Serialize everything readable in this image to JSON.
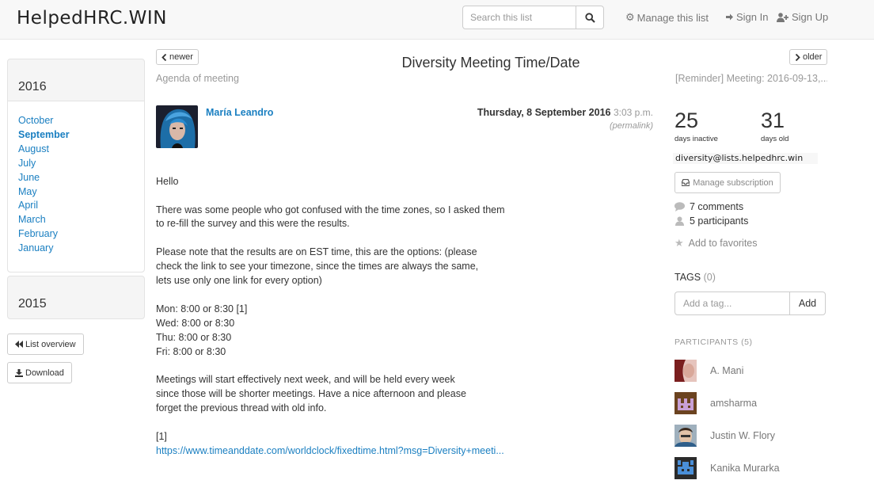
{
  "navbar": {
    "brand": "HelpedHRC.WIN",
    "search_placeholder": "Search this list",
    "manage": "Manage this list",
    "sign_in": "Sign In",
    "sign_up": "Sign Up"
  },
  "sidebar": {
    "year_current": "2016",
    "months": [
      "October",
      "September",
      "August",
      "July",
      "June",
      "May",
      "April",
      "March",
      "February",
      "January"
    ],
    "active_month": "September",
    "year_previous": "2015",
    "list_overview": "List overview",
    "download": "Download"
  },
  "thread": {
    "newer": "newer",
    "older": "older",
    "title": "Diversity Meeting Time/Date",
    "prev_thread": "Agenda of meeting",
    "next_thread": "[Reminder] Meeting: 2016-09-13,..."
  },
  "message": {
    "sender": "María Leandro",
    "date": "Thursday, 8 September 2016",
    "time": "3:03 p.m.",
    "permalink": "(permalink)",
    "body": [
      "Hello",
      "There was some people who got confused with the time zones, so I asked them",
      "to re-fill the survey and this were the results.",
      "Please note that the results are on EST time, this are the options: (please",
      "check the link to see your timezone, since the times are always the same,",
      "lets use only one link for every option)",
      "Mon: 8:00 or 8:30 [1]",
      "Wed: 8:00 or 8:30",
      "Thu: 8:00 or 8:30",
      "Fri: 8:00 or 8:30",
      "Meetings will start effectively next week, and will be held every week",
      "since those will be shorter meetings. Have a nice afternoon and please",
      "forget the previous thread with old info.",
      "[1]"
    ],
    "link": "https://www.timeanddate.com/worldclock/fixedtime.html?msg=Diversity+meeti..."
  },
  "stats": {
    "inactive_num": "25",
    "inactive_label": "days inactive",
    "old_num": "31",
    "old_label": "days old",
    "list_address": "diversity@lists.helpedhrc.win",
    "manage_subscription": "Manage subscription",
    "comments": "7 comments",
    "participants": "5 participants",
    "favorites": "Add to favorites"
  },
  "tags": {
    "heading": "TAGS",
    "count": "(0)",
    "placeholder": "Add a tag...",
    "add": "Add"
  },
  "participants": {
    "heading": "PARTICIPANTS",
    "count": "(5)",
    "names": [
      "A. Mani",
      "amsharma",
      "Justin W. Flory",
      "Kanika Murarka"
    ]
  },
  "colors": {
    "link": "#1a7fc1",
    "muted": "#999999",
    "navbar_bg": "#f8f8f8"
  }
}
